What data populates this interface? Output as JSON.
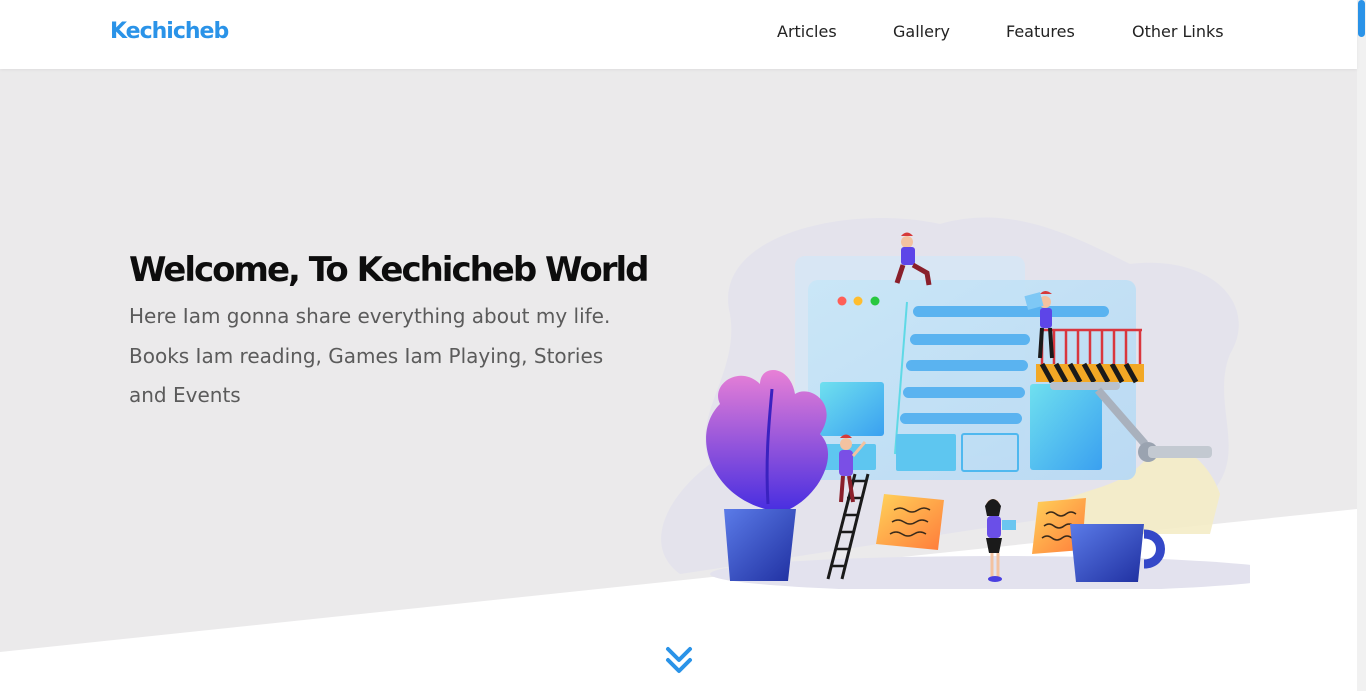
{
  "header": {
    "logo": "Kechicheb",
    "nav": [
      {
        "label": "Articles"
      },
      {
        "label": "Gallery"
      },
      {
        "label": "Features"
      },
      {
        "label": "Other Links"
      }
    ]
  },
  "hero": {
    "title": "Welcome, To Kechicheb World",
    "text": "Here Iam gonna share everything about my life. Books Iam reading, Games Iam Playing, Stories and Events"
  },
  "icons": {
    "scroll_down": "chevron-double-down-icon"
  },
  "colors": {
    "accent": "#2a93e8",
    "hero_bg": "#ebeaeb",
    "text_dark": "#0d0d0d",
    "text_muted": "#5b5b5b"
  }
}
